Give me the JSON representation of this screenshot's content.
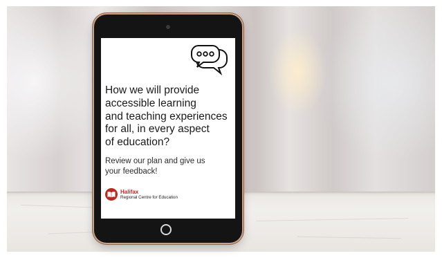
{
  "screen": {
    "headline": "How we will provide\naccessible learning\nand teaching experiences\nfor all, in every aspect\nof education?",
    "subtext": "Review our plan and give us\nyour feedback!"
  },
  "logo": {
    "name": "Halifax",
    "subtitle": "Regional Centre for Education"
  },
  "icons": {
    "chat": "speech-bubbles-icon",
    "logo_mark": "open-book-logo-icon"
  },
  "colors": {
    "brand_red": "#b82b24",
    "tablet_frame": "#141414",
    "tablet_trim": "#c9a184"
  }
}
